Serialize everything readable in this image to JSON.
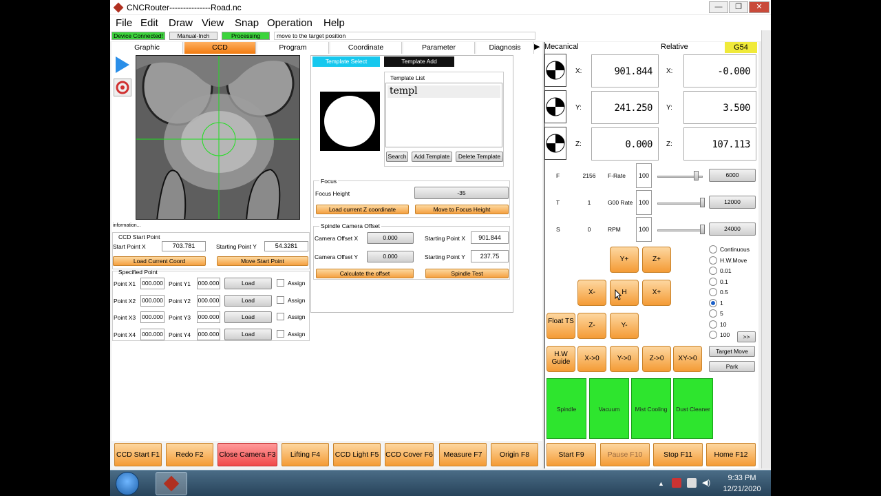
{
  "window": {
    "title": "CNCRouter---------------Road.nc"
  },
  "menu": [
    "File",
    "Edit",
    "Draw",
    "View",
    "Snap",
    "Operation",
    "Help"
  ],
  "status": {
    "device": "Device Connected!",
    "mode": "Manual-Inch",
    "state": "Processing",
    "message": "move to the target position"
  },
  "tabs": [
    "Graphic",
    "CCD",
    "Program",
    "Coordinate",
    "Parameter",
    "Diagnosis"
  ],
  "ccd": {
    "information": "information...",
    "start_point_title": "CCD Start Point",
    "start_x_label": "Start Point X",
    "start_x": "703.781",
    "start_y_label": "Starting Point Y",
    "start_y": "54.3281",
    "load_current": "Load Current Coord",
    "move_start": "Move Start Point",
    "specified_title": "Specified Point",
    "points": [
      {
        "xl": "Point X1",
        "x": "000.000",
        "yl": "Point Y1",
        "y": "000.000"
      },
      {
        "xl": "Point X2",
        "x": "000.000",
        "yl": "Point Y2",
        "y": "000.000"
      },
      {
        "xl": "Point X3",
        "x": "000.000",
        "yl": "Point Y3",
        "y": "000.000"
      },
      {
        "xl": "Point X4",
        "x": "000.000",
        "yl": "Point Y4",
        "y": "000.000"
      }
    ],
    "load": "Load",
    "assign": "Assign"
  },
  "template": {
    "tab_select": "Template Select",
    "tab_add": "Template Add",
    "list_title": "Template List",
    "item": "templ",
    "search": "Search",
    "add": "Add Template",
    "delete": "Delete Template",
    "focus_title": "Focus",
    "focus_label": "Focus Height",
    "focus_value": "-35",
    "load_z": "Load current Z coordinate",
    "move_focus": "Move to Focus Height",
    "offset_title": "Spindle Camera Offset",
    "cam_x_label": "Camera Offset X",
    "cam_x": "0.000",
    "cam_y_label": "Camera Offset Y",
    "cam_y": "0.000",
    "start_x_label": "Starting Point X",
    "start_x": "901.844",
    "start_y_label": "Starting Point Y",
    "start_y": "237.75",
    "calc": "Calculate the offset",
    "spindle_test": "Spindle Test"
  },
  "coords": {
    "mech_label": "Mecanical",
    "rel_label": "Relative",
    "wcs": "G54",
    "axes": [
      {
        "l": "X:",
        "mech": "901.844",
        "rel": "-0.000"
      },
      {
        "l": "Y:",
        "mech": "241.250",
        "rel": "3.500"
      },
      {
        "l": "Z:",
        "mech": "0.000",
        "rel": "107.113"
      }
    ]
  },
  "feeds": [
    {
      "l": "F",
      "v": "2156",
      "n": "F-Rate",
      "p": "100",
      "s": "6000",
      "level": 0.85
    },
    {
      "l": "T",
      "v": "1",
      "n": "G00 Rate",
      "p": "100",
      "s": "12000",
      "level": 1.0
    },
    {
      "l": "S",
      "v": "0",
      "n": "RPM",
      "p": "100",
      "s": "24000",
      "level": 1.0
    }
  ],
  "jog": {
    "yplus": "Y+",
    "zplus": "Z+",
    "xminus": "X-",
    "h": "H",
    "xplus": "X+",
    "float": "Float TS",
    "zminus": "Z-",
    "yminus": "Y-",
    "hw": "H.W Guide",
    "x0": "X->0",
    "y0": "Y->0",
    "z0": "Z->0",
    "xy0": "XY->0"
  },
  "steps": [
    "Continuous",
    "H.W.Move",
    "0.01",
    "0.1",
    "0.5",
    "1",
    "5",
    "10",
    "100"
  ],
  "selected_step": "1",
  "more": ">>",
  "target_move": "Target Move",
  "park": "Park",
  "toggles": [
    "Spindle",
    "Vacuum",
    "Mist Cooling",
    "Dust Cleaner"
  ],
  "fkeys": [
    "CCD Start F1",
    "Redo F2",
    "Close Camera F3",
    "Lifting F4",
    "CCD Light F5",
    "CCD Cover F6",
    "Measure F7",
    "Origin F8"
  ],
  "fkeys_right": [
    "Start F9",
    "Pause F10",
    "Stop F11",
    "Home F12"
  ],
  "clock": {
    "time": "9:33 PM",
    "date": "12/21/2020"
  },
  "colors": {
    "orange": "#f49b35",
    "green": "#2ee52e",
    "active_tab": "#f7941d",
    "wcs": "#f0ea3a"
  }
}
